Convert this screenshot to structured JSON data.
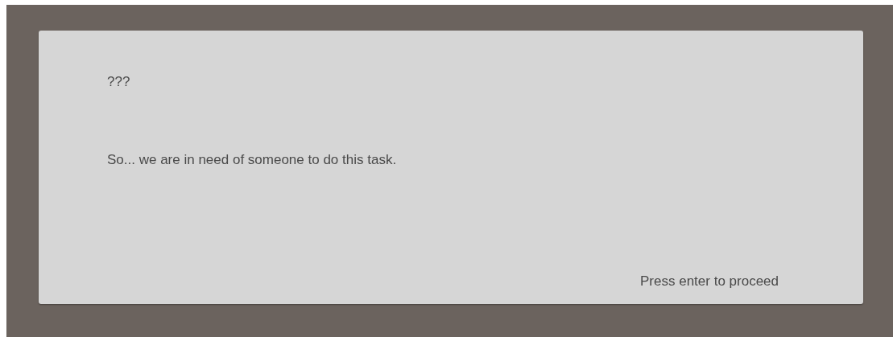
{
  "dialog": {
    "speaker": "???",
    "message": "So... we are in need of someone to do this task.",
    "prompt": "Press enter to proceed"
  }
}
